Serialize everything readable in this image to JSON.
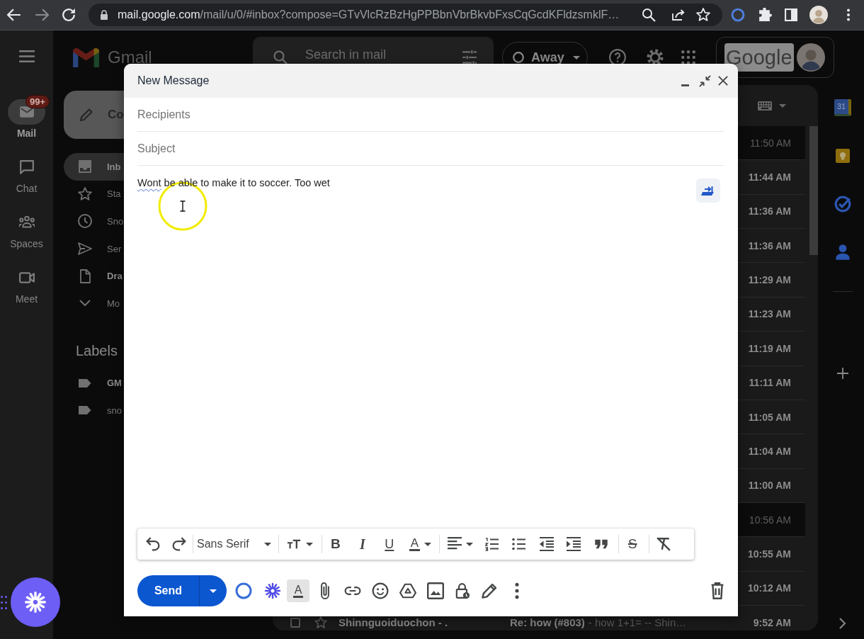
{
  "browser": {
    "url": {
      "host": "mail.google.com",
      "path": "/mail/u/0/#inbox?compose=GTvVlcRzBzHgPPBbnVbrBkvbFxsCqGcdKFldzsmklF…"
    },
    "forward": {
      "disabled": true
    }
  },
  "rail": {
    "items": [
      {
        "label": "Mail",
        "selected": true,
        "badge": "99+"
      },
      {
        "label": "Chat",
        "selected": false
      },
      {
        "label": "Spaces",
        "selected": false
      },
      {
        "label": "Meet",
        "selected": false
      }
    ]
  },
  "header": {
    "product": "Gmail",
    "search": {
      "placeholder": "Search in mail"
    },
    "status": {
      "label": "Away"
    },
    "account_logo": "Google"
  },
  "nav": {
    "compose": "Co",
    "items": [
      {
        "label": "Inb",
        "selected": true,
        "unread": true
      },
      {
        "label": "Sta",
        "selected": false,
        "unread": false
      },
      {
        "label": "Sno",
        "selected": false,
        "unread": false
      },
      {
        "label": "Ser",
        "selected": false,
        "unread": false
      },
      {
        "label": "Dra",
        "selected": false,
        "unread": true
      },
      {
        "label": "Mo",
        "selected": false,
        "unread": false
      }
    ],
    "labels_heading": "Labels",
    "labels": [
      {
        "label": "GM",
        "unread": true
      },
      {
        "label": "sno",
        "unread": false
      }
    ]
  },
  "inbox": {
    "rows": [
      {
        "time": "11:50 AM",
        "unread": false
      },
      {
        "time": "11:44 AM",
        "unread": true
      },
      {
        "time": "11:36 AM",
        "unread": true
      },
      {
        "time": "11:36 AM",
        "unread": true
      },
      {
        "time": "11:29 AM",
        "unread": true
      },
      {
        "time": "11:23 AM",
        "unread": true
      },
      {
        "time": "11:19 AM",
        "unread": true
      },
      {
        "time": "11:11 AM",
        "unread": true
      },
      {
        "time": "11:05 AM",
        "unread": true
      },
      {
        "time": "11:04 AM",
        "unread": true
      },
      {
        "time": "11:00 AM",
        "unread": true
      },
      {
        "time": "10:56 AM",
        "unread": false
      },
      {
        "time": "10:55 AM",
        "unread": true
      },
      {
        "time": "10:12 AM",
        "unread": true
      },
      {
        "time": "9:52 AM",
        "unread": true,
        "checked": false,
        "starred": false,
        "sender": "Shinnguoiduochon - .",
        "subject": "Re: how (#803)",
        "snippet": "- how 1+1= -- Shin…"
      }
    ]
  },
  "side_panel": {
    "calendar_date": "31"
  },
  "compose": {
    "title": "New Message",
    "recipients": {
      "placeholder": "Recipients"
    },
    "subject": {
      "placeholder": "Subject"
    },
    "body": [
      {
        "text": "Wont",
        "misspelled": true
      },
      {
        "text": " be able to make it to soccer. Too wet",
        "misspelled": false
      }
    ],
    "format_bar": {
      "font": "Sans Serif",
      "bold": "B",
      "italic": "I",
      "underline": "U",
      "text_color": "A",
      "strikethrough": "S"
    },
    "send": "Send",
    "format_toggle": {
      "label": "A",
      "selected": true
    }
  }
}
